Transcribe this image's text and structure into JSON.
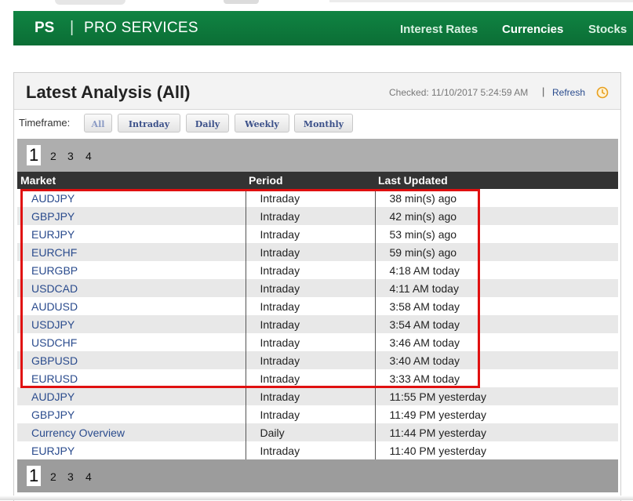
{
  "brand": {
    "abbr": "PS",
    "separator": "|",
    "name": "PRO SERVICES"
  },
  "nav": [
    {
      "label": "Interest Rates",
      "active": false
    },
    {
      "label": "Currencies",
      "active": true
    },
    {
      "label": "Stocks",
      "active": false
    }
  ],
  "panel": {
    "title": "Latest Analysis (All)",
    "checked": "Checked: 11/10/2017 5:24:59 AM",
    "separator": "|",
    "refresh": "Refresh"
  },
  "timeframe": {
    "label": "Timeframe:",
    "options": [
      "All",
      "Intraday",
      "Daily",
      "Weekly",
      "Monthly"
    ],
    "active": "All"
  },
  "pagination": {
    "pages": [
      "1",
      "2",
      "3",
      "4"
    ],
    "current": "1"
  },
  "table": {
    "headers": [
      "Market",
      "Period",
      "Last Updated"
    ],
    "rows": [
      {
        "market": "AUDJPY",
        "period": "Intraday",
        "updated": "38 min(s) ago"
      },
      {
        "market": "GBPJPY",
        "period": "Intraday",
        "updated": "42 min(s) ago"
      },
      {
        "market": "EURJPY",
        "period": "Intraday",
        "updated": "53 min(s) ago"
      },
      {
        "market": "EURCHF",
        "period": "Intraday",
        "updated": "59 min(s) ago"
      },
      {
        "market": "EURGBP",
        "period": "Intraday",
        "updated": "4:18 AM today"
      },
      {
        "market": "USDCAD",
        "period": "Intraday",
        "updated": "4:11 AM today"
      },
      {
        "market": "AUDUSD",
        "period": "Intraday",
        "updated": "3:58 AM today"
      },
      {
        "market": "USDJPY",
        "period": "Intraday",
        "updated": "3:54 AM today"
      },
      {
        "market": "USDCHF",
        "period": "Intraday",
        "updated": "3:46 AM today"
      },
      {
        "market": "GBPUSD",
        "period": "Intraday",
        "updated": "3:40 AM today"
      },
      {
        "market": "EURUSD",
        "period": "Intraday",
        "updated": "3:33 AM today"
      },
      {
        "market": "AUDJPY",
        "period": "Intraday",
        "updated": "11:55 PM yesterday"
      },
      {
        "market": "GBPJPY",
        "period": "Intraday",
        "updated": "11:49 PM yesterday"
      },
      {
        "market": "Currency Overview",
        "period": "Daily",
        "updated": "11:44 PM yesterday"
      },
      {
        "market": "EURJPY",
        "period": "Intraday",
        "updated": "11:40 PM yesterday"
      }
    ]
  },
  "colors": {
    "navbar": "#0c7a3b",
    "link": "#2a4b8d",
    "highlight": "#e01010",
    "header_row": "#333333",
    "refresh_icon": "#e8a020"
  },
  "icons": {
    "refresh": "clock-icon"
  }
}
